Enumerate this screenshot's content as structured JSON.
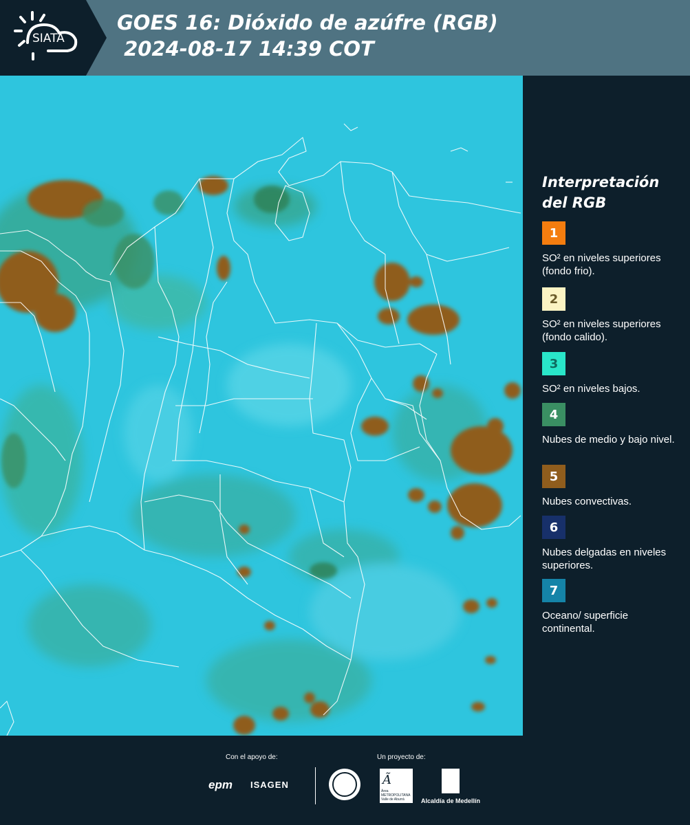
{
  "header": {
    "logo_text": "SIATA",
    "title_line1": "GOES 16: Dióxido de azúfre (RGB)",
    "title_line2": " 2024-08-17 14:39 COT"
  },
  "legend": {
    "title": "Interpretación del RGB",
    "items": [
      {
        "number": "1",
        "color": "#f47d0f",
        "text": "SO² en niveles superiores (fondo frio)."
      },
      {
        "number": "2",
        "color": "#fbf3c3",
        "text": "SO² en niveles superiores (fondo calido)."
      },
      {
        "number": "3",
        "color": "#29e6c9",
        "text": "SO² en niveles bajos."
      },
      {
        "number": "4",
        "color": "#3a8f63",
        "text": "Nubes de medio y bajo nivel."
      },
      {
        "number": "5",
        "color": "#8f5d1d",
        "text": "Nubes convectivas."
      },
      {
        "number": "6",
        "color": "#17306a",
        "text": "Nubes delgadas en niveles superiores."
      },
      {
        "number": "7",
        "color": "#1584a8",
        "text": "Oceano/ superficie continental."
      }
    ]
  },
  "footer": {
    "support_label": "Con el apoyo de:",
    "project_label": "Un proyecto de:",
    "sponsor_1": "epm",
    "sponsor_2": "ISAGEN",
    "partner_1": "Área METROPOLITANA Valle de Aburrá",
    "partner_2": "Alcaldía de Medellín"
  },
  "colors": {
    "background": "#0d1f2b",
    "header_band": "#4f7382",
    "map_base": "#2cc6e0",
    "convective_cloud": "#8f5d1d",
    "low_cloud": "#3a8f63"
  }
}
